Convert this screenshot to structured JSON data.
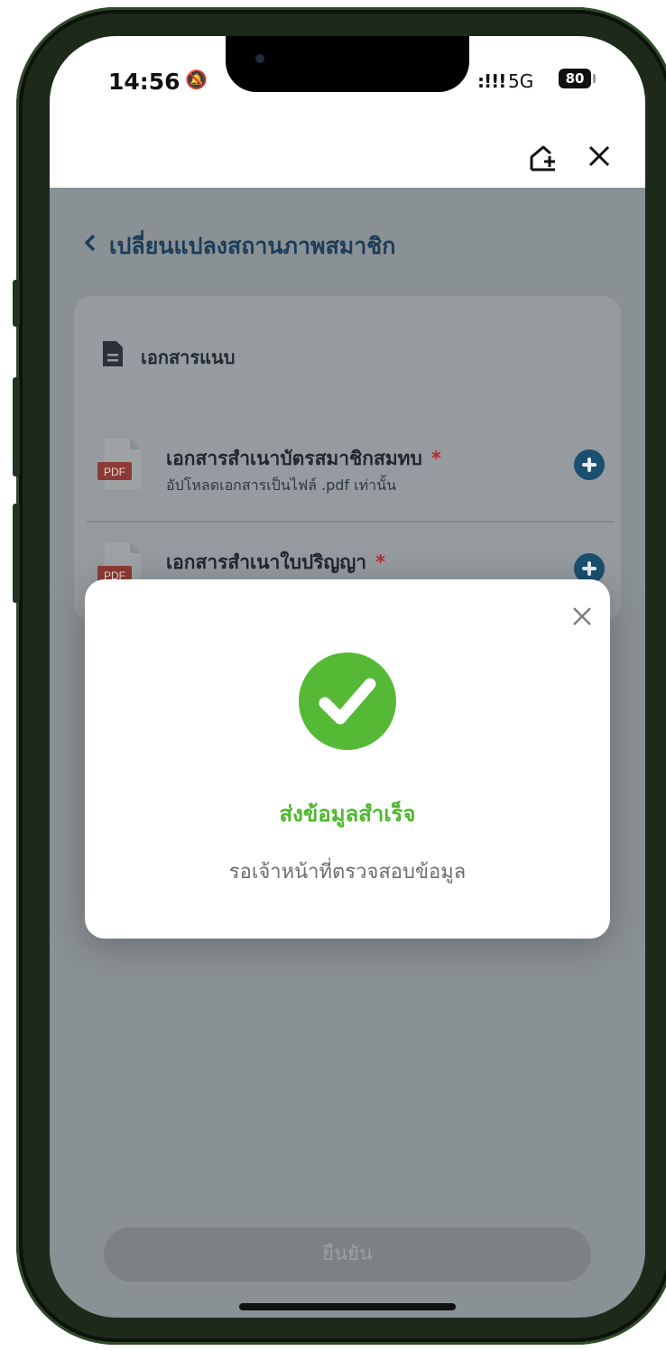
{
  "status_bar": {
    "time": "14:56",
    "signal": ":!!!",
    "network": "5G",
    "battery": "80"
  },
  "page": {
    "title": "เปลี่ยนแปลงสถานภาพสมาชิก",
    "section_label": "เอกสารแนบ",
    "documents": [
      {
        "title": "เอกสารสำเนาบัตรสมาชิกสมทบ",
        "required_mark": "*",
        "hint": "อัปโหลดเอกสารเป็นไฟล์ .pdf เท่านั้น",
        "file_badge": "PDF"
      },
      {
        "title": "เอกสารสำเนาใบปริญญา",
        "required_mark": "*",
        "file_badge": "PDF"
      }
    ],
    "confirm_label": "ยืนยัน"
  },
  "modal": {
    "title": "ส่งข้อมูลสำเร็จ",
    "message": "รอเจ้าหน้าที่ตรวจสอบข้อมูล",
    "icon": "check-circle-icon"
  },
  "colors": {
    "success": "#4cb82a",
    "accent": "#1a4f70",
    "required": "#b03030"
  }
}
